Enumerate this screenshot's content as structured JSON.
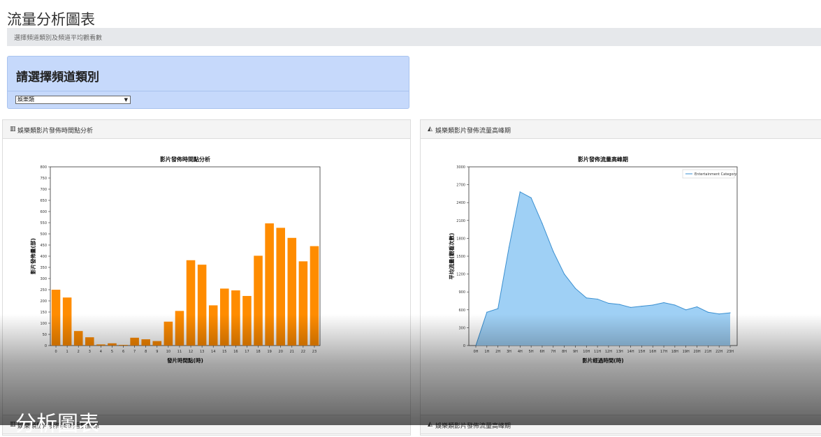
{
  "page": {
    "title": "流量分析圖表",
    "subtitle": "選擇頻道類別及頻道平均觀看數"
  },
  "selector": {
    "heading": "請選擇頻道類別",
    "value": "娛樂類",
    "caret_icon": "dropdown-caret"
  },
  "cards": {
    "left": {
      "icon": "bar-chart-icon",
      "title": "娛樂類影片發佈時間點分析"
    },
    "right": {
      "icon": "area-chart-icon",
      "title": "娛樂類影片發佈流量高峰期"
    },
    "bottom_left": {
      "title": "娛樂類影片發佈與觀看數關係"
    },
    "bottom_right": {
      "title": "娛樂類影片發佈流量高峰期"
    }
  },
  "overlay": {
    "caption": "分析圖表"
  },
  "chart_data": [
    {
      "type": "bar",
      "title": "影片發佈時間點分析",
      "xlabel": "發片時間點(時)",
      "ylabel": "影片發佈量(部)",
      "categories": [
        "0",
        "1",
        "2",
        "3",
        "4",
        "5",
        "6",
        "7",
        "8",
        "9",
        "10",
        "11",
        "12",
        "13",
        "14",
        "15",
        "16",
        "17",
        "18",
        "19",
        "20",
        "21",
        "22",
        "23"
      ],
      "values": [
        250,
        215,
        65,
        37,
        5,
        10,
        3,
        35,
        28,
        20,
        107,
        155,
        382,
        362,
        180,
        255,
        247,
        222,
        402,
        547,
        527,
        482,
        377,
        445
      ],
      "ylim": [
        0,
        800
      ],
      "yticks": [
        0,
        50,
        100,
        150,
        200,
        250,
        300,
        350,
        400,
        450,
        500,
        550,
        600,
        650,
        700,
        750,
        800
      ],
      "color": "#ff8c00",
      "grid": false
    },
    {
      "type": "area",
      "title": "影片發佈流量高峰期",
      "xlabel": "影片經過時間(時)",
      "ylabel": "平均流量(觀看次數)",
      "categories": [
        "0H",
        "1H",
        "2H",
        "3H",
        "4H",
        "5H",
        "6H",
        "7H",
        "8H",
        "9H",
        "10H",
        "11H",
        "12H",
        "13H",
        "14H",
        "15H",
        "16H",
        "17H",
        "18H",
        "19H",
        "20H",
        "21H",
        "22H",
        "23H"
      ],
      "series": [
        {
          "name": "Entertainment Category",
          "values": [
            0,
            560,
            620,
            1650,
            2580,
            2480,
            2050,
            1580,
            1200,
            960,
            800,
            780,
            710,
            690,
            640,
            660,
            680,
            720,
            680,
            600,
            650,
            560,
            530,
            550
          ]
        }
      ],
      "ylim": [
        0,
        3000
      ],
      "yticks": [
        0,
        300,
        600,
        900,
        1200,
        1500,
        1800,
        2100,
        2400,
        2700,
        3000
      ],
      "legend": "top-right",
      "fill": "#9fd0f5",
      "line": "#3a8fd0",
      "grid": false
    }
  ]
}
